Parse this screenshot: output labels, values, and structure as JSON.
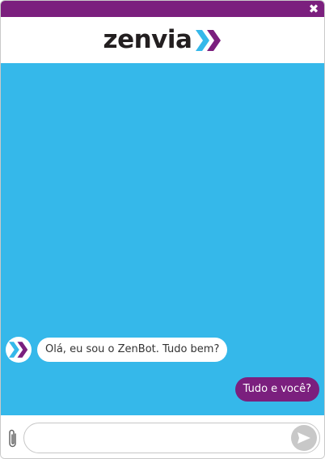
{
  "header": {
    "brand_name": "zenvia",
    "close_symbol": "✖",
    "close_icon": "close-icon",
    "brand_icon": "double-chevron-icon"
  },
  "chat": {
    "messages": [
      {
        "sender": "bot",
        "text": "Olá, eu sou o ZenBot. Tudo bem?"
      },
      {
        "sender": "user",
        "text": "Tudo e você?"
      }
    ]
  },
  "composer": {
    "value": "",
    "placeholder": "",
    "attach_icon": "paperclip-icon",
    "send_icon": "send-icon"
  },
  "colors": {
    "brand_purple": "#7b1f7e",
    "chat_background": "#35b8ea",
    "chevron_blue": "#35b8ea",
    "chevron_purple": "#7b1f7e",
    "send_button": "#c8c8c8"
  }
}
